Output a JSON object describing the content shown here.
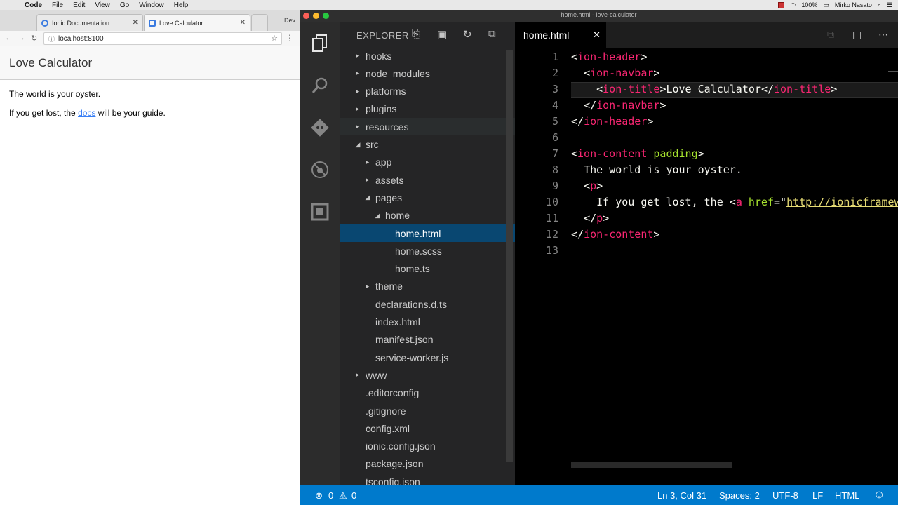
{
  "menubar": {
    "items": [
      "Code",
      "File",
      "Edit",
      "View",
      "Go",
      "Window",
      "Help"
    ],
    "battery": "100%",
    "user": "Mirko Nasato"
  },
  "browser": {
    "tabs": [
      {
        "label": "Ionic Documentation"
      },
      {
        "label": "Love Calculator"
      }
    ],
    "dev_label": "Dev",
    "url": "localhost:8100",
    "app_title": "Love Calculator",
    "line1": "The world is your oyster.",
    "line2_prefix": "If you get lost, the ",
    "line2_link": "docs",
    "line2_suffix": " will be your guide."
  },
  "vscode": {
    "window_title": "home.html - love-calculator",
    "explorer_label": "EXPLORER",
    "tree": [
      {
        "label": "hooks",
        "depth": 0,
        "arrow": "▸"
      },
      {
        "label": "node_modules",
        "depth": 0,
        "arrow": "▸"
      },
      {
        "label": "platforms",
        "depth": 0,
        "arrow": "▸"
      },
      {
        "label": "plugins",
        "depth": 0,
        "arrow": "▸"
      },
      {
        "label": "resources",
        "depth": 0,
        "arrow": "▸"
      },
      {
        "label": "src",
        "depth": 0,
        "arrow": "◢"
      },
      {
        "label": "app",
        "depth": 1,
        "arrow": "▸"
      },
      {
        "label": "assets",
        "depth": 1,
        "arrow": "▸"
      },
      {
        "label": "pages",
        "depth": 1,
        "arrow": "◢"
      },
      {
        "label": "home",
        "depth": 2,
        "arrow": "◢"
      },
      {
        "label": "home.html",
        "depth": 3,
        "arrow": ""
      },
      {
        "label": "home.scss",
        "depth": 3,
        "arrow": ""
      },
      {
        "label": "home.ts",
        "depth": 3,
        "arrow": ""
      },
      {
        "label": "theme",
        "depth": 1,
        "arrow": "▸"
      },
      {
        "label": "declarations.d.ts",
        "depth": 1,
        "arrow": ""
      },
      {
        "label": "index.html",
        "depth": 1,
        "arrow": ""
      },
      {
        "label": "manifest.json",
        "depth": 1,
        "arrow": ""
      },
      {
        "label": "service-worker.js",
        "depth": 1,
        "arrow": ""
      },
      {
        "label": "www",
        "depth": 0,
        "arrow": "▸"
      },
      {
        "label": ".editorconfig",
        "depth": 0,
        "arrow": ""
      },
      {
        "label": ".gitignore",
        "depth": 0,
        "arrow": ""
      },
      {
        "label": "config.xml",
        "depth": 0,
        "arrow": ""
      },
      {
        "label": "ionic.config.json",
        "depth": 0,
        "arrow": ""
      },
      {
        "label": "package.json",
        "depth": 0,
        "arrow": ""
      },
      {
        "label": "tsconfig.json",
        "depth": 0,
        "arrow": ""
      }
    ],
    "editor_tab": "home.html",
    "line_numbers": [
      "1",
      "2",
      "3",
      "4",
      "5",
      "6",
      "7",
      "8",
      "9",
      "10",
      "11",
      "12",
      "13"
    ],
    "code": {
      "ion_header": "ion-header",
      "ion_navbar": "ion-navbar",
      "ion_title": "ion-title",
      "title_text": "Love Calculator",
      "ion_content": "ion-content",
      "padding_attr": "padding",
      "oyster_text": "The world is your oyster.",
      "p_tag": "p",
      "lost_text": "If you get lost, the ",
      "a_tag": "a",
      "href_attr": "href",
      "href_value": "http://ionicframew"
    },
    "status": {
      "errors": "0",
      "warnings": "0",
      "position": "Ln 3, Col 31",
      "spaces": "Spaces: 2",
      "encoding": "UTF-8",
      "eol": "LF",
      "language": "HTML"
    }
  }
}
